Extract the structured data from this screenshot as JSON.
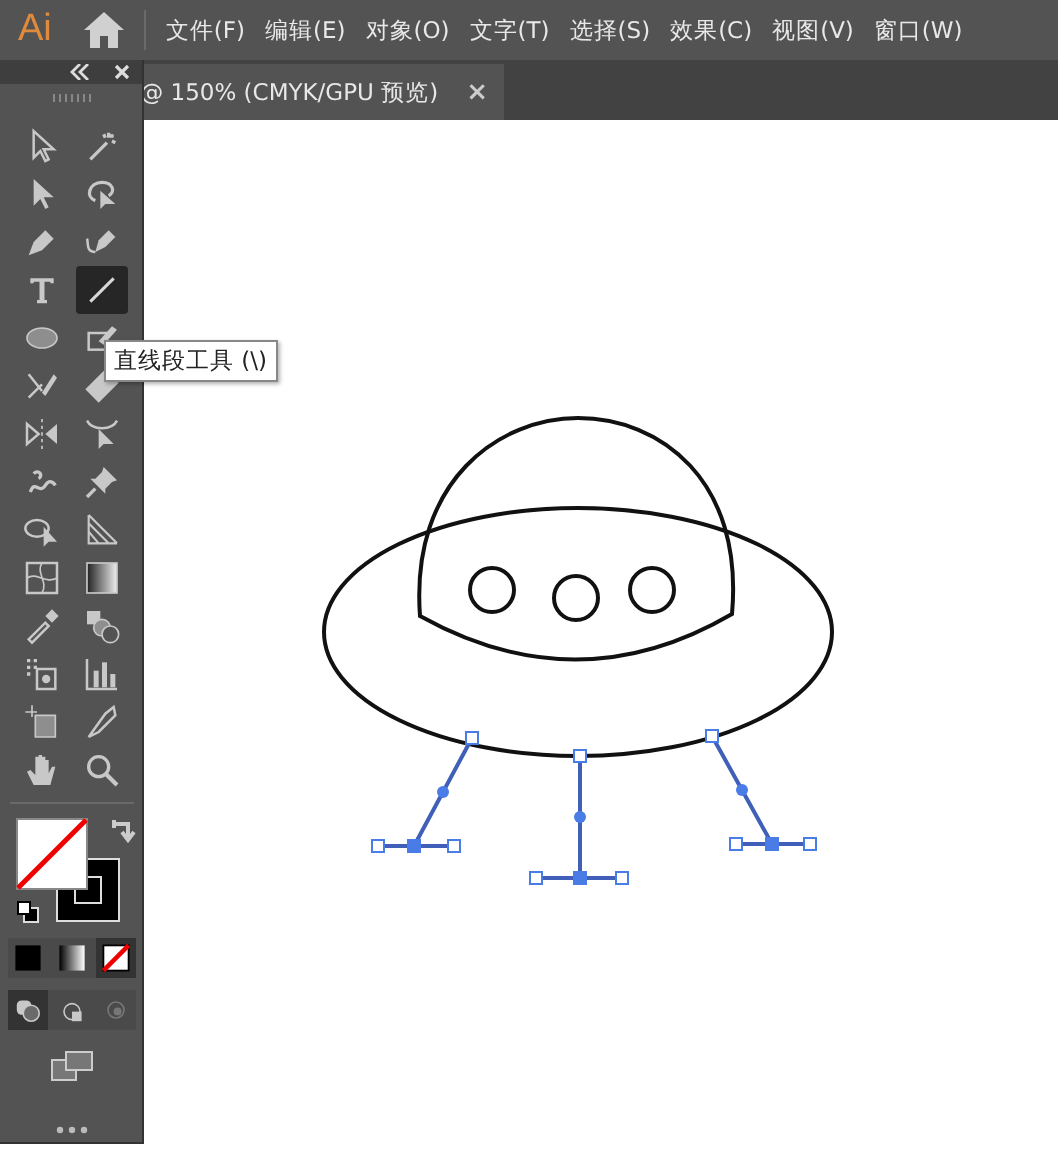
{
  "app_bar": {
    "logo": "Ai",
    "menus": [
      "文件(F)",
      "编辑(E)",
      "对象(O)",
      "文字(T)",
      "选择(S)",
      "效果(C)",
      "视图(V)",
      "窗口(W)"
    ]
  },
  "document_tab": {
    "title": "@ 150% (CMYK/GPU 预览)",
    "close": "×"
  },
  "toolbar": {
    "tools": [
      {
        "selected": false
      },
      {
        "selected": false
      },
      {
        "selected": false
      },
      {
        "selected": false
      },
      {
        "selected": false
      },
      {
        "selected": false
      },
      {
        "selected": false
      },
      {
        "selected": true
      },
      {
        "selected": false
      },
      {
        "selected": false
      },
      {
        "selected": false
      },
      {
        "selected": false
      },
      {
        "selected": false
      },
      {
        "selected": false
      },
      {
        "selected": false
      },
      {
        "selected": false
      },
      {
        "selected": false
      },
      {
        "selected": false
      },
      {
        "selected": false
      },
      {
        "selected": false
      },
      {
        "selected": false
      },
      {
        "selected": false
      },
      {
        "selected": false
      },
      {
        "selected": false
      },
      {
        "selected": false
      },
      {
        "selected": false
      },
      {
        "selected": false
      },
      {
        "selected": false
      }
    ],
    "color_modes": [
      {
        "selected": false
      },
      {
        "selected": false
      },
      {
        "selected": true
      }
    ],
    "draw_modes": [
      {
        "selected": true
      },
      {
        "selected": false
      },
      {
        "selected": false
      }
    ]
  },
  "tooltip": "直线段工具 (\\)"
}
